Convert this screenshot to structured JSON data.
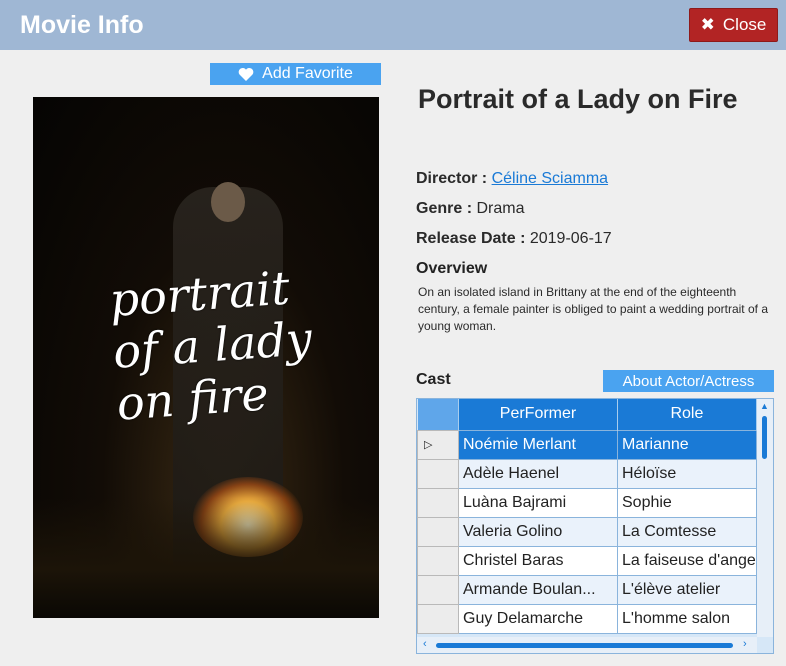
{
  "window": {
    "title": "Movie Info",
    "close_label": "Close"
  },
  "favorite": {
    "label": "Add Favorite"
  },
  "movie": {
    "title": "Portrait of a Lady on Fire",
    "poster_script": "portrait of a lady on fire",
    "director_label": "Director :",
    "director": "Céline Sciamma",
    "genre_label": "Genre :",
    "genre": "Drama",
    "release_label": "Release Date :",
    "release_date": "2019-06-17",
    "overview_label": "Overview",
    "overview": "On an isolated island in Brittany at the end of the eighteenth century, a female painter is obliged to paint a wedding portrait of a young woman."
  },
  "cast": {
    "label": "Cast",
    "about_label": "About Actor/Actress",
    "columns": [
      "PerFormer",
      "Role"
    ],
    "rows": [
      {
        "performer": "Noémie Merlant",
        "role": "Marianne"
      },
      {
        "performer": "Adèle Haenel",
        "role": "Héloïse"
      },
      {
        "performer": "Luàna Bajrami",
        "role": "Sophie"
      },
      {
        "performer": "Valeria Golino",
        "role": "La Comtesse"
      },
      {
        "performer": "Christel Baras",
        "role": "La faiseuse d'ange"
      },
      {
        "performer": "Armande Boulan...",
        "role": "L'élève atelier"
      },
      {
        "performer": "Guy Delamarche",
        "role": "L'homme salon"
      }
    ]
  },
  "colors": {
    "titlebar": "#9fb7d4",
    "close": "#b22424",
    "accent": "#4aa3f0",
    "selection": "#1a7ad6"
  }
}
